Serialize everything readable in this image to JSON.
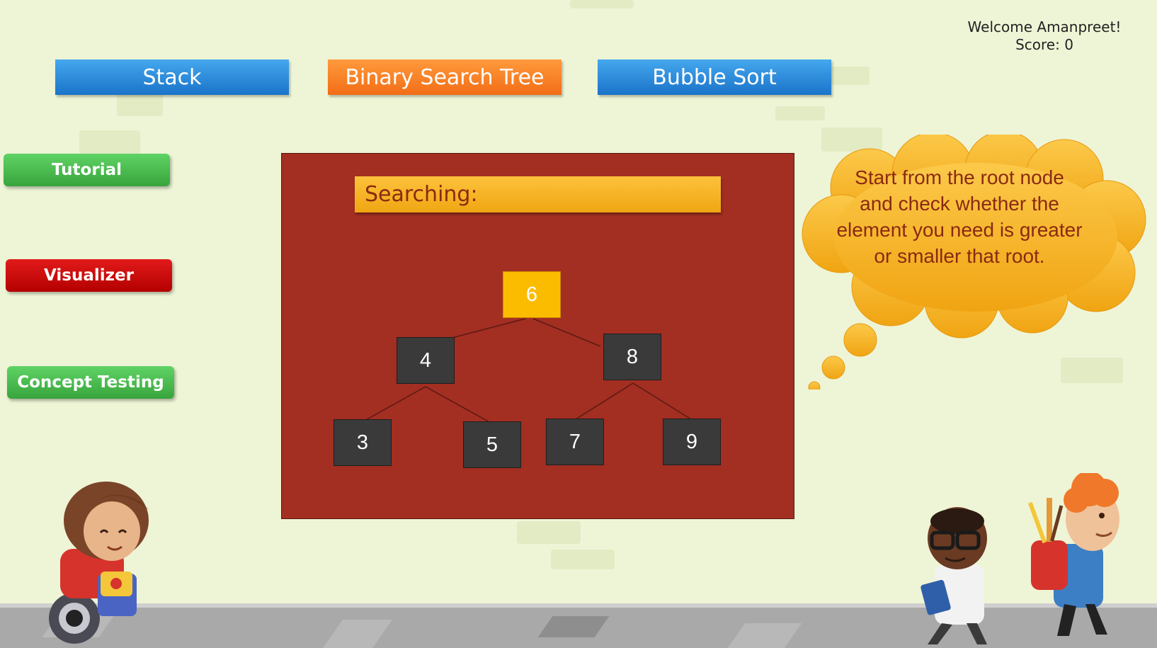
{
  "user": {
    "welcome": "Welcome Amanpreet!",
    "score": "Score: 0"
  },
  "tabs": [
    {
      "label": "Stack",
      "state": "inactive"
    },
    {
      "label": "Binary Search Tree",
      "state": "active"
    },
    {
      "label": "Bubble Sort",
      "state": "inactive"
    }
  ],
  "sidebar": {
    "tutorial": "Tutorial",
    "visualizer": "Visualizer",
    "concept_testing": "Concept Testing"
  },
  "panel": {
    "search_label": "Searching:",
    "nodes": {
      "root": "6",
      "left": "4",
      "right": "8",
      "ll": "3",
      "lr": "5",
      "rl": "7",
      "rr": "9"
    },
    "highlighted_node": "6"
  },
  "hint": "Start from the root node and check whether the element you need is greater or smaller that root.",
  "colors": {
    "tab_blue": "#1a73c9",
    "tab_active": "#f26d16",
    "panel_bg": "#a32e22",
    "node_bg": "#3a3a3a",
    "node_active": "#fbbc00",
    "search_bar": "#f0a612",
    "cloud": "#f5b021"
  },
  "characters": [
    "girl-wheelchair-illustration",
    "boy-glasses-illustration",
    "boy-backpack-illustration"
  ]
}
